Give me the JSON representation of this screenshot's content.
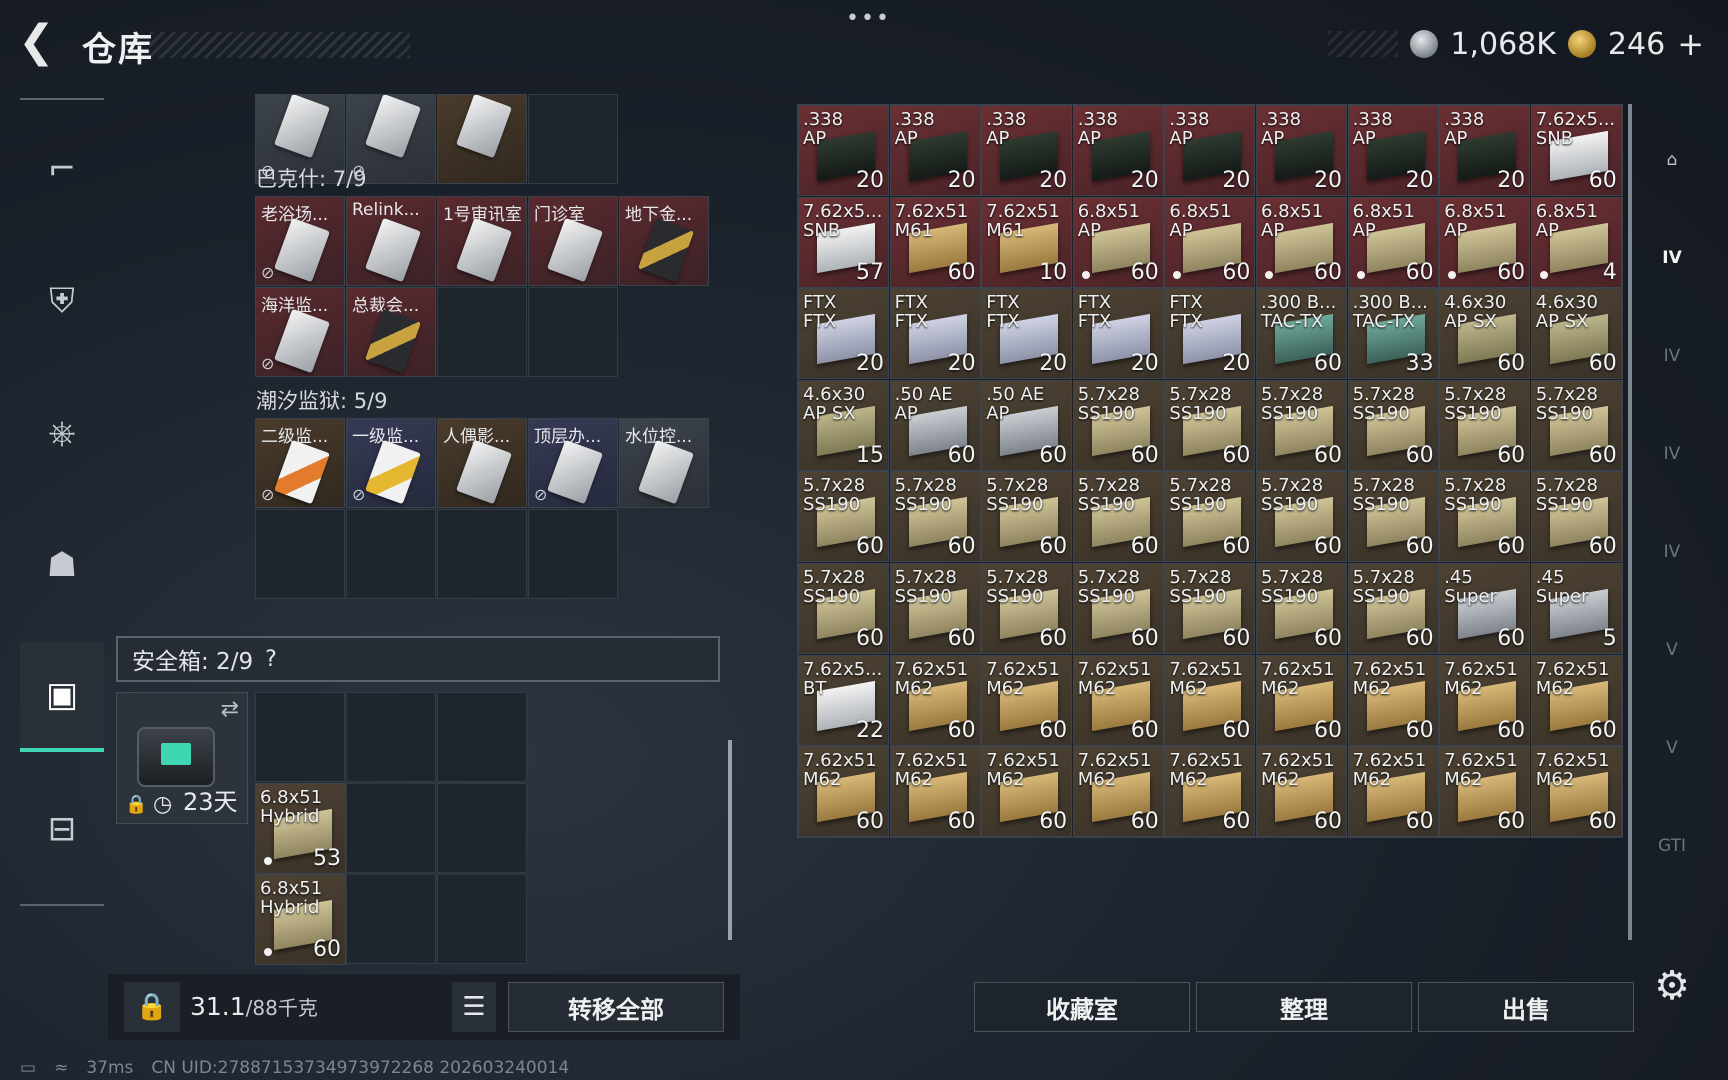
{
  "header": {
    "title": "仓库",
    "more_label": "•••",
    "currency_silver": "1,068K",
    "currency_gold": "246",
    "plus_label": "+"
  },
  "sidebar": {
    "items": [
      {
        "icon": "pistol-icon",
        "glyph": "⌐"
      },
      {
        "icon": "vest-icon",
        "glyph": "⛨"
      },
      {
        "icon": "backpack-icon",
        "glyph": "⎈"
      },
      {
        "icon": "pouch-icon",
        "glyph": "☗"
      },
      {
        "icon": "safebox-icon",
        "glyph": "▣",
        "active": true
      },
      {
        "icon": "briefcase-icon",
        "glyph": "⊟"
      }
    ]
  },
  "left": {
    "top_partial": [
      {
        "name": "",
        "variant": "gray",
        "nolink": true
      },
      {
        "name": "",
        "variant": "gray",
        "nolink": true
      },
      {
        "name": "",
        "variant": "brown",
        "nolink": false
      }
    ],
    "section1": {
      "label": "巴克什: 7/9",
      "cards": [
        {
          "name": "老浴场...",
          "variant": "red",
          "img": "white",
          "nolink": true
        },
        {
          "name": "Relink...",
          "variant": "red",
          "img": "white",
          "nolink": false
        },
        {
          "name": "1号审讯室",
          "variant": "red",
          "img": "white",
          "nolink": false
        },
        {
          "name": "门诊室",
          "variant": "red",
          "img": "white",
          "nolink": false
        },
        {
          "name": "地下金...",
          "variant": "red",
          "img": "gold",
          "nolink": false
        },
        {
          "name": "海洋监...",
          "variant": "red",
          "img": "white",
          "nolink": true
        },
        {
          "name": "总裁会...",
          "variant": "red",
          "img": "gold",
          "nolink": false
        }
      ]
    },
    "section2": {
      "label": "潮汐监狱: 5/9",
      "cards": [
        {
          "name": "二级监...",
          "variant": "brown",
          "img": "orange",
          "nolink": true
        },
        {
          "name": "一级监...",
          "variant": "navy",
          "img": "yellow",
          "nolink": true
        },
        {
          "name": "人偶影...",
          "variant": "brown",
          "img": "white",
          "nolink": false
        },
        {
          "name": "顶层办...",
          "variant": "navy",
          "img": "white",
          "nolink": true
        },
        {
          "name": "水位控...",
          "variant": "gray",
          "img": "white",
          "nolink": false
        }
      ]
    },
    "safebox": {
      "label": "安全箱: 2/9",
      "help": "?",
      "days": "23天",
      "items": [
        {
          "l1": "6.8x51",
          "l2": "Hybrid",
          "qty": "53"
        },
        {
          "l1": "6.8x51",
          "l2": "Hybrid",
          "qty": "60"
        }
      ]
    },
    "weight_value": "31.1",
    "weight_max": "/88千克",
    "transfer_all": "转移全部"
  },
  "grid": {
    "rows": [
      [
        {
          "l1": ".338",
          "l2": "AP",
          "qty": "20",
          "bg": "red",
          "box": "dark"
        },
        {
          "l1": ".338",
          "l2": "AP",
          "qty": "20",
          "bg": "red",
          "box": "dark"
        },
        {
          "l1": ".338",
          "l2": "AP",
          "qty": "20",
          "bg": "red",
          "box": "dark"
        },
        {
          "l1": ".338",
          "l2": "AP",
          "qty": "20",
          "bg": "red",
          "box": "dark"
        },
        {
          "l1": ".338",
          "l2": "AP",
          "qty": "20",
          "bg": "red",
          "box": "dark"
        },
        {
          "l1": ".338",
          "l2": "AP",
          "qty": "20",
          "bg": "red",
          "box": "dark"
        },
        {
          "l1": ".338",
          "l2": "AP",
          "qty": "20",
          "bg": "red",
          "box": "dark"
        },
        {
          "l1": ".338",
          "l2": "AP",
          "qty": "20",
          "bg": "red",
          "box": "dark"
        },
        {
          "l1": "7.62x5...",
          "l2": "SNB",
          "qty": "60",
          "bg": "red",
          "box": "white"
        }
      ],
      [
        {
          "l1": "7.62x5...",
          "l2": "SNB",
          "qty": "57",
          "bg": "red",
          "box": "white"
        },
        {
          "l1": "7.62x51",
          "l2": "M61",
          "qty": "60",
          "bg": "red",
          "box": "tan"
        },
        {
          "l1": "7.62x51",
          "l2": "M61",
          "qty": "10",
          "bg": "red",
          "box": "tan"
        },
        {
          "l1": "6.8x51",
          "l2": "AP",
          "qty": "60",
          "bg": "red",
          "box": "khaki",
          "dot": true
        },
        {
          "l1": "6.8x51",
          "l2": "AP",
          "qty": "60",
          "bg": "red",
          "box": "khaki",
          "dot": true
        },
        {
          "l1": "6.8x51",
          "l2": "AP",
          "qty": "60",
          "bg": "red",
          "box": "khaki",
          "dot": true
        },
        {
          "l1": "6.8x51",
          "l2": "AP",
          "qty": "60",
          "bg": "red",
          "box": "khaki",
          "dot": true
        },
        {
          "l1": "6.8x51",
          "l2": "AP",
          "qty": "60",
          "bg": "red",
          "box": "khaki",
          "dot": true
        },
        {
          "l1": "6.8x51",
          "l2": "AP",
          "qty": "4",
          "bg": "red",
          "box": "khaki",
          "dot": true
        }
      ],
      [
        {
          "l1": "FTX",
          "l2": "FTX",
          "qty": "20",
          "bg": "brown",
          "box": "lav"
        },
        {
          "l1": "FTX",
          "l2": "FTX",
          "qty": "20",
          "bg": "brown",
          "box": "lav"
        },
        {
          "l1": "FTX",
          "l2": "FTX",
          "qty": "20",
          "bg": "brown",
          "box": "lav"
        },
        {
          "l1": "FTX",
          "l2": "FTX",
          "qty": "20",
          "bg": "brown",
          "box": "lav"
        },
        {
          "l1": "FTX",
          "l2": "FTX",
          "qty": "20",
          "bg": "brown",
          "box": "lav"
        },
        {
          "l1": ".300 B...",
          "l2": "TAC-TX",
          "qty": "60",
          "bg": "brown",
          "box": "teal"
        },
        {
          "l1": ".300 B...",
          "l2": "TAC-TX",
          "qty": "33",
          "bg": "brown",
          "box": "teal"
        },
        {
          "l1": "4.6x30",
          "l2": "AP SX",
          "qty": "60",
          "bg": "brown",
          "box": "olive"
        },
        {
          "l1": "4.6x30",
          "l2": "AP SX",
          "qty": "60",
          "bg": "brown",
          "box": "olive"
        }
      ],
      [
        {
          "l1": "4.6x30",
          "l2": "AP SX",
          "qty": "15",
          "bg": "brown",
          "box": "olive"
        },
        {
          "l1": ".50 AE",
          "l2": "AP",
          "qty": "60",
          "bg": "brown",
          "box": "silver"
        },
        {
          "l1": ".50 AE",
          "l2": "AP",
          "qty": "60",
          "bg": "brown",
          "box": "silver"
        },
        {
          "l1": "5.7x28",
          "l2": "SS190",
          "qty": "60",
          "bg": "brown",
          "box": "khaki"
        },
        {
          "l1": "5.7x28",
          "l2": "SS190",
          "qty": "60",
          "bg": "brown",
          "box": "khaki"
        },
        {
          "l1": "5.7x28",
          "l2": "SS190",
          "qty": "60",
          "bg": "brown",
          "box": "khaki"
        },
        {
          "l1": "5.7x28",
          "l2": "SS190",
          "qty": "60",
          "bg": "brown",
          "box": "khaki"
        },
        {
          "l1": "5.7x28",
          "l2": "SS190",
          "qty": "60",
          "bg": "brown",
          "box": "khaki"
        },
        {
          "l1": "5.7x28",
          "l2": "SS190",
          "qty": "60",
          "bg": "brown",
          "box": "khaki"
        }
      ],
      [
        {
          "l1": "5.7x28",
          "l2": "SS190",
          "qty": "60",
          "bg": "brown",
          "box": "khaki"
        },
        {
          "l1": "5.7x28",
          "l2": "SS190",
          "qty": "60",
          "bg": "brown",
          "box": "khaki"
        },
        {
          "l1": "5.7x28",
          "l2": "SS190",
          "qty": "60",
          "bg": "brown",
          "box": "khaki"
        },
        {
          "l1": "5.7x28",
          "l2": "SS190",
          "qty": "60",
          "bg": "brown",
          "box": "khaki"
        },
        {
          "l1": "5.7x28",
          "l2": "SS190",
          "qty": "60",
          "bg": "brown",
          "box": "khaki"
        },
        {
          "l1": "5.7x28",
          "l2": "SS190",
          "qty": "60",
          "bg": "brown",
          "box": "khaki"
        },
        {
          "l1": "5.7x28",
          "l2": "SS190",
          "qty": "60",
          "bg": "brown",
          "box": "khaki"
        },
        {
          "l1": "5.7x28",
          "l2": "SS190",
          "qty": "60",
          "bg": "brown",
          "box": "khaki"
        },
        {
          "l1": "5.7x28",
          "l2": "SS190",
          "qty": "60",
          "bg": "brown",
          "box": "khaki"
        }
      ],
      [
        {
          "l1": "5.7x28",
          "l2": "SS190",
          "qty": "60",
          "bg": "brown",
          "box": "khaki"
        },
        {
          "l1": "5.7x28",
          "l2": "SS190",
          "qty": "60",
          "bg": "brown",
          "box": "khaki"
        },
        {
          "l1": "5.7x28",
          "l2": "SS190",
          "qty": "60",
          "bg": "brown",
          "box": "khaki"
        },
        {
          "l1": "5.7x28",
          "l2": "SS190",
          "qty": "60",
          "bg": "brown",
          "box": "khaki"
        },
        {
          "l1": "5.7x28",
          "l2": "SS190",
          "qty": "60",
          "bg": "brown",
          "box": "khaki"
        },
        {
          "l1": "5.7x28",
          "l2": "SS190",
          "qty": "60",
          "bg": "brown",
          "box": "khaki"
        },
        {
          "l1": "5.7x28",
          "l2": "SS190",
          "qty": "60",
          "bg": "brown",
          "box": "khaki"
        },
        {
          "l1": ".45",
          "l2": "Super",
          "qty": "60",
          "bg": "brown",
          "box": "silver"
        },
        {
          "l1": ".45",
          "l2": "Super",
          "qty": "5",
          "bg": "brown",
          "box": "silver"
        }
      ],
      [
        {
          "l1": "7.62x5...",
          "l2": "BT",
          "qty": "22",
          "bg": "brown",
          "box": "white"
        },
        {
          "l1": "7.62x51",
          "l2": "M62",
          "qty": "60",
          "bg": "brown",
          "box": "tan"
        },
        {
          "l1": "7.62x51",
          "l2": "M62",
          "qty": "60",
          "bg": "brown",
          "box": "tan"
        },
        {
          "l1": "7.62x51",
          "l2": "M62",
          "qty": "60",
          "bg": "brown",
          "box": "tan"
        },
        {
          "l1": "7.62x51",
          "l2": "M62",
          "qty": "60",
          "bg": "brown",
          "box": "tan"
        },
        {
          "l1": "7.62x51",
          "l2": "M62",
          "qty": "60",
          "bg": "brown",
          "box": "tan"
        },
        {
          "l1": "7.62x51",
          "l2": "M62",
          "qty": "60",
          "bg": "brown",
          "box": "tan"
        },
        {
          "l1": "7.62x51",
          "l2": "M62",
          "qty": "60",
          "bg": "brown",
          "box": "tan"
        },
        {
          "l1": "7.62x51",
          "l2": "M62",
          "qty": "60",
          "bg": "brown",
          "box": "tan"
        }
      ],
      [
        {
          "l1": "7.62x51",
          "l2": "M62",
          "qty": "60",
          "bg": "brown",
          "box": "tan"
        },
        {
          "l1": "7.62x51",
          "l2": "M62",
          "qty": "60",
          "bg": "brown",
          "box": "tan"
        },
        {
          "l1": "7.62x51",
          "l2": "M62",
          "qty": "60",
          "bg": "brown",
          "box": "tan"
        },
        {
          "l1": "7.62x51",
          "l2": "M62",
          "qty": "60",
          "bg": "brown",
          "box": "tan"
        },
        {
          "l1": "7.62x51",
          "l2": "M62",
          "qty": "60",
          "bg": "brown",
          "box": "tan"
        },
        {
          "l1": "7.62x51",
          "l2": "M62",
          "qty": "60",
          "bg": "brown",
          "box": "tan"
        },
        {
          "l1": "7.62x51",
          "l2": "M62",
          "qty": "60",
          "bg": "brown",
          "box": "tan"
        },
        {
          "l1": "7.62x51",
          "l2": "M62",
          "qty": "60",
          "bg": "brown",
          "box": "tan"
        },
        {
          "l1": "7.62x51",
          "l2": "M62",
          "qty": "60",
          "bg": "brown",
          "box": "tan"
        }
      ]
    ]
  },
  "right_tabs": [
    {
      "label": "⌂",
      "icon": "vault-icon",
      "style": "normal"
    },
    {
      "label": "IV",
      "icon": "folder-icon",
      "style": "bold"
    },
    {
      "label": "IV",
      "icon": "folder-icon",
      "style": "dim"
    },
    {
      "label": "IV",
      "icon": "folder-icon",
      "style": "dim"
    },
    {
      "label": "IV",
      "icon": "folder-plus-icon",
      "style": "dim"
    },
    {
      "label": "V",
      "icon": "key-case-icon",
      "style": "dim"
    },
    {
      "label": "V",
      "icon": "key-case-icon",
      "style": "dim"
    },
    {
      "label": "GTI",
      "icon": "gti-icon",
      "style": "dim"
    }
  ],
  "bottom_buttons": {
    "collection": "收藏室",
    "sort": "整理",
    "sell": "出售"
  },
  "status": {
    "ping": "37ms",
    "uid": "CN UID:278871537349739722​68 202603240014"
  },
  "colors": {
    "accent": "#3fd6b4",
    "red_slot": "#6b3034",
    "brown_slot": "#4d4233"
  }
}
